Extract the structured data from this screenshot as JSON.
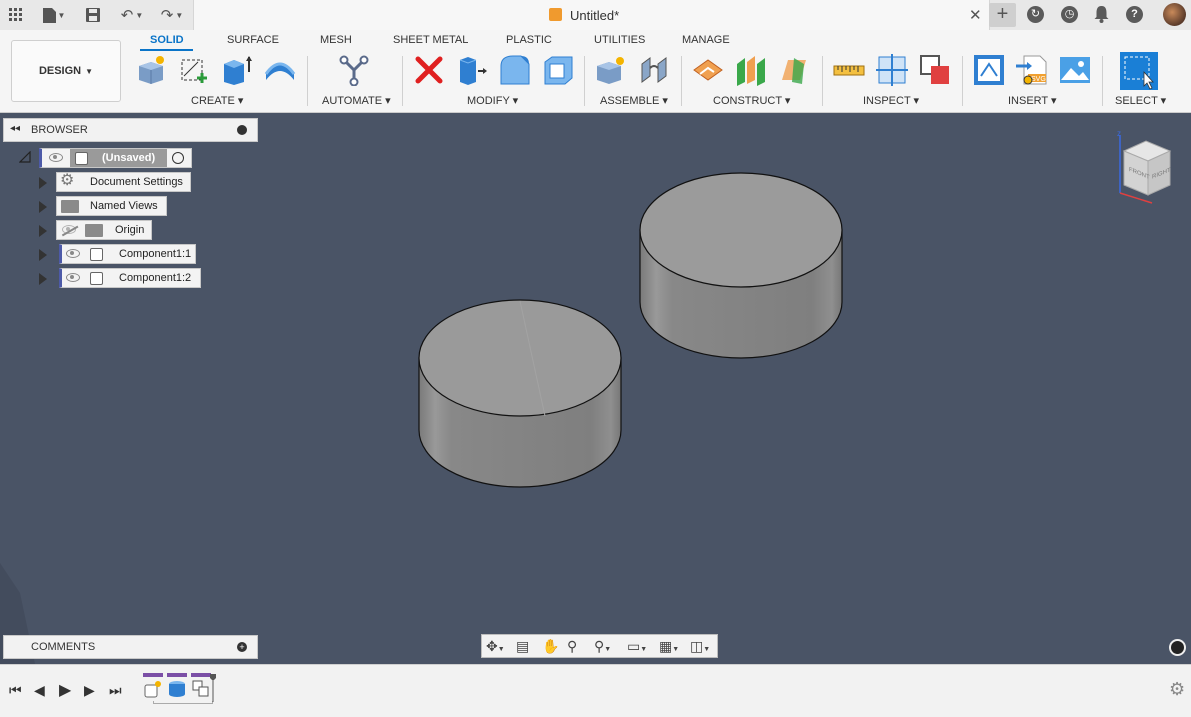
{
  "titlebar": {
    "apps_icon": "grid-icon",
    "doc_title": "Untitled*",
    "close": "✕",
    "new_tab": "+",
    "right_icons": [
      "job-status-icon",
      "clock-icon",
      "notification-bell-icon",
      "help-icon",
      "user-avatar"
    ]
  },
  "workspace": {
    "mode_label": "DESIGN",
    "tabs": [
      "SOLID",
      "SURFACE",
      "MESH",
      "SHEET METAL",
      "PLASTIC",
      "UTILITIES",
      "MANAGE"
    ],
    "active_tab": "SOLID"
  },
  "groups": {
    "create": "CREATE",
    "automate": "AUTOMATE",
    "modify": "MODIFY",
    "assemble": "ASSEMBLE",
    "construct": "CONSTRUCT",
    "inspect": "INSPECT",
    "insert": "INSERT",
    "select": "SELECT"
  },
  "browser": {
    "header": "BROWSER",
    "root": "(Unsaved)",
    "items": [
      {
        "label": "Document Settings",
        "icon": "gear-icon"
      },
      {
        "label": "Named Views",
        "icon": "folder-icon"
      },
      {
        "label": "Origin",
        "icon": "folder-icon"
      },
      {
        "label": "Component1:1",
        "icon": "component-icon"
      },
      {
        "label": "Component1:2",
        "icon": "component-icon"
      }
    ]
  },
  "comments": {
    "header": "COMMENTS"
  },
  "viewcube": {
    "faces": [
      "FRONT",
      "RIGHT"
    ]
  },
  "colors": {
    "accent": "#0a74c8",
    "viewport_bg": "#4a5466",
    "body_gray": "#8c8c8c",
    "component_stripe": "#4d5aa8",
    "timeline_marker": "#7b4fa6"
  }
}
